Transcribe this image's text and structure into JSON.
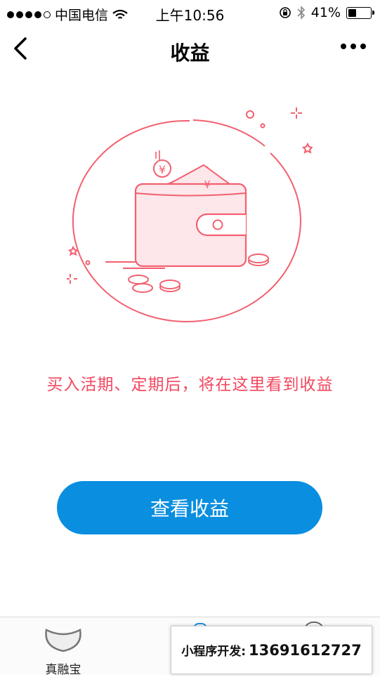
{
  "status_bar": {
    "carrier": "中国电信",
    "time": "上午10:56",
    "battery_percent": "41%",
    "battery_level": 0.41,
    "signal_bars": 4
  },
  "nav": {
    "title": "收益"
  },
  "illustration": {
    "currency_symbol": "¥"
  },
  "main": {
    "empty_message": "买入活期、定期后，将在这里看到收益",
    "view_button_label": "查看收益"
  },
  "tab_bar": {
    "home_label": "真融宝"
  },
  "banner": {
    "label": "小程序开发:",
    "phone": "13691612727"
  },
  "colors": {
    "accent_blue": "#0a8ee0",
    "message_red": "#f3485f",
    "illustration_pink": "#f2606f"
  }
}
